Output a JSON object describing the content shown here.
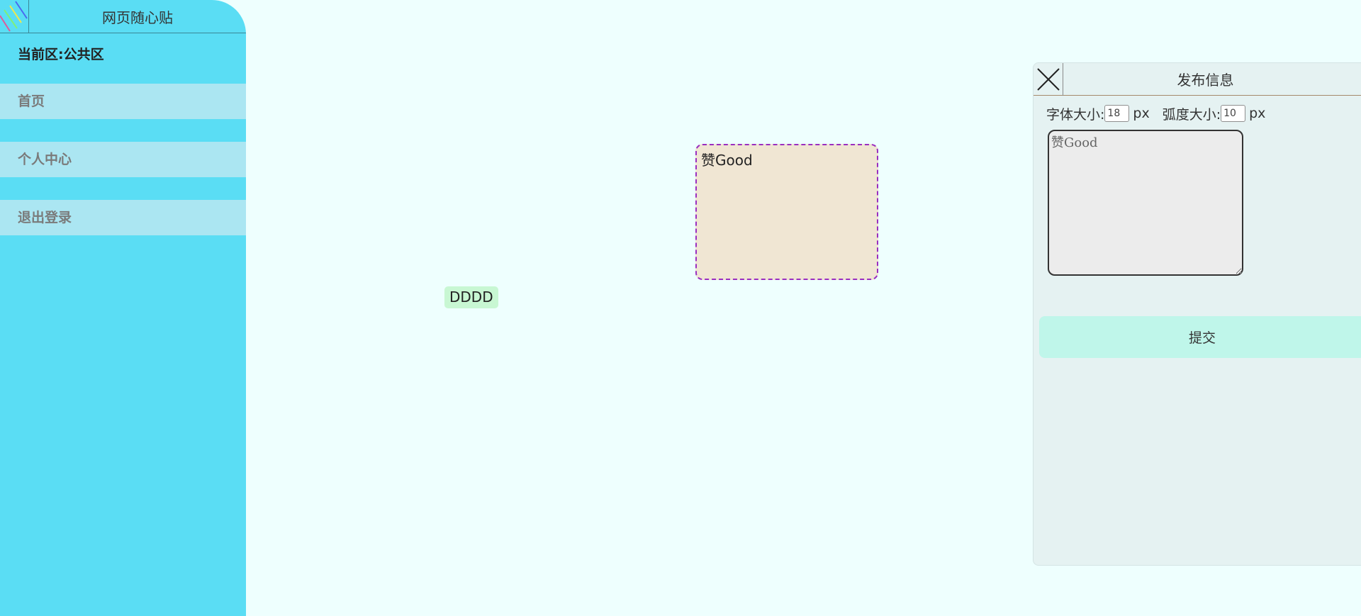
{
  "sidebar": {
    "app_title": "网页随心贴",
    "current_area": "当前区:公共区",
    "nav": {
      "home": "首页",
      "profile": "个人中心",
      "logout": "退出登录"
    }
  },
  "board": {
    "notes": [
      {
        "text": "赞Good",
        "background": "#f0e6d3",
        "selected": true
      },
      {
        "text": "DDDD",
        "background": "#c8f7d3",
        "selected": false
      }
    ]
  },
  "publish_panel": {
    "title": "发布信息",
    "font_size_label": "字体大小:",
    "font_size_value": "18",
    "font_size_unit": "px",
    "radius_label": "弧度大小:",
    "radius_value": "10",
    "radius_unit": "px",
    "content_value": "赞Good",
    "submit_label": "提交"
  },
  "colors": {
    "background": "#eefffe",
    "sidebar": "#5addf4",
    "nav_item": "#abe6f2",
    "panel": "#e5f2f2",
    "submit": "#bff6ea",
    "selected_border": "#9a2ec0"
  },
  "icons": {
    "logo": "striped-lines-icon",
    "close": "close-icon"
  }
}
